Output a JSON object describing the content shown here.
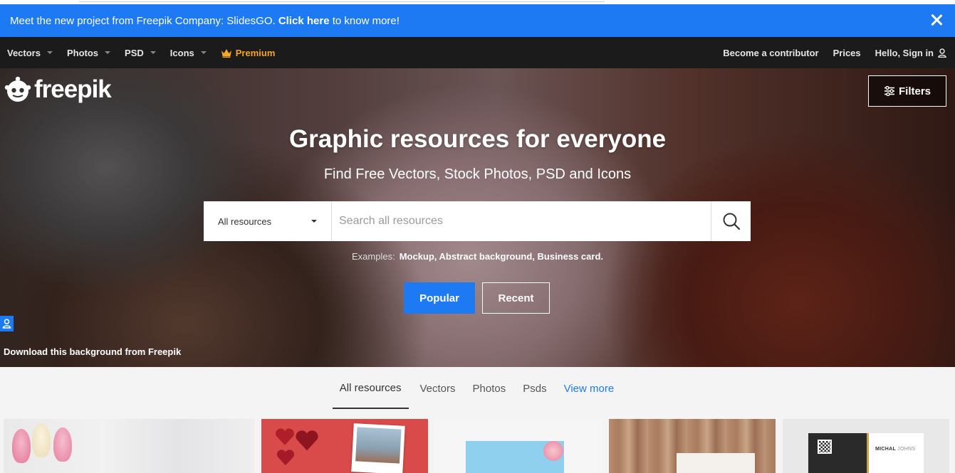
{
  "banner": {
    "text_before": "Meet the new project from Freepik Company: SlidesGO. ",
    "link_text": "Click here",
    "text_after": " to know more!"
  },
  "nav": {
    "items": [
      {
        "label": "Vectors"
      },
      {
        "label": "Photos"
      },
      {
        "label": "PSD"
      },
      {
        "label": "Icons"
      }
    ],
    "premium_label": "Premium",
    "contributor_label": "Become a contributor",
    "prices_label": "Prices",
    "signin_label": "Hello, Sign in"
  },
  "hero": {
    "logo_text": "freepik",
    "filters_label": "Filters",
    "headline": "Graphic resources for everyone",
    "subheadline": "Find Free Vectors, Stock Photos, PSD and Icons",
    "search": {
      "category_selected": "All resources",
      "placeholder": "Search all resources"
    },
    "examples_label": "Examples:",
    "examples_links": "Mockup, Abstract background, Business card.",
    "popular_label": "Popular",
    "recent_label": "Recent",
    "credit_text": "Download this background from Freepik"
  },
  "tabs": {
    "items": [
      {
        "label": "All resources",
        "active": true
      },
      {
        "label": "Vectors"
      },
      {
        "label": "Photos"
      },
      {
        "label": "Psds"
      }
    ],
    "more_label": "View more"
  },
  "thumbnails": {
    "t5_name_first": "MICHAL",
    "t5_name_last": "JOHNS"
  },
  "colors": {
    "accent_blue": "#1d7af3",
    "nav_bg": "#1b1b1b",
    "premium_gold": "#f5a623"
  }
}
